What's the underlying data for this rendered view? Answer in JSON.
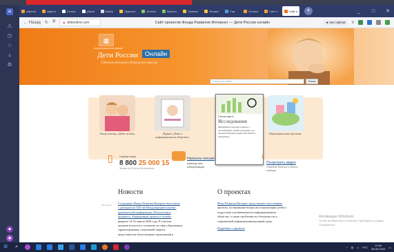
{
  "browser": {
    "tabs": [
      {
        "label": "sapienti",
        "active": false
      },
      {
        "label": "sapient",
        "active": false
      },
      {
        "label": "Статьи",
        "active": false
      },
      {
        "label": "pdfpdf",
        "active": false
      },
      {
        "label": "Кибер",
        "active": false
      },
      {
        "label": "Правила",
        "active": false
      },
      {
        "label": "Оплата",
        "active": false
      },
      {
        "label": "Валюта",
        "active": false
      },
      {
        "label": "Гуманит",
        "active": false
      },
      {
        "label": "Финанс",
        "active": false
      },
      {
        "label": "Faq",
        "active": false
      },
      {
        "label": "Оплата",
        "active": false
      },
      {
        "label": "Сайт п",
        "active": false
      },
      {
        "label": "Сайт п",
        "active": true
      }
    ],
    "tab_add": "+",
    "window_buttons": [
      "_",
      "□",
      "✕"
    ],
    "back_label": "← Назад",
    "url": "detionline.com",
    "page_title": "Сайт проектов Фонда Развития Интернет — Дети России онлайн",
    "bookmark_label": "★ Нет сайтов",
    "colors": {
      "tabstrip": "#2f3b68",
      "banner": "#f07b16",
      "link": "#1a4f8b",
      "accent": "#e8751b"
    }
  },
  "site": {
    "logo_caption": "ФОНД РАЗВИТИЯ ИНТЕРНЕТ",
    "logo_main": "Дети России",
    "logo_badge": "Онлайн",
    "slogan": "Сделаем интернет безопаснее вместе",
    "search_placeholder": "Поиск на сайте",
    "search_button": "Поиск"
  },
  "cards": [
    {
      "label": "Линия помощи «Дети онлайн»"
    },
    {
      "label": "Журнал «Дети в информационном обществе»"
    },
    {
      "label": "Образовательные проекты"
    }
  ],
  "popup": {
    "kicker": "Статистика и",
    "title": "Исследования",
    "text": "Проводятся научные опросы и исследования, чтобы понимать, на сколько безопасна среда для детей в интернете."
  },
  "hotline": {
    "label": "Горячая линия",
    "number_a": "8 800",
    "number_b": "25 000 15",
    "note": "Звонки по России бесплатные"
  },
  "chat": {
    "link": "Написать письмо",
    "sub": "помощь или консультация"
  },
  "video": {
    "link": "Посмотреть видео",
    "sub": "Узнайте больше о Линии помощи"
  },
  "news": {
    "heading": "Новости",
    "date": "обновлено",
    "lines": [
      "Сотрудники Фонда Развития Интернет выступили",
      "с докладом на XIII-ой Международной научно-",
      "практической конференции «Психология и",
      "интернет». Конференция прошла в онлайн-",
      "формате 14-16 апреля 2020 года. В участии",
      "приняли психологи, специалисты сфер образования,",
      "здравоохранения, социальной защиты,",
      "представители общественных организаций и"
    ]
  },
  "about": {
    "heading": "О проектах",
    "lines": [
      "Фонд Развития Интернет представляет свои главные",
      "проекты, посвящённые вопросам социализации детей и",
      "подростков в развивающемся информационном",
      "обществе, а также проблемам их безопасности в",
      "современной инфокоммуникационной среде."
    ],
    "more": "Подробнее о проектах"
  },
  "watermark": {
    "line1": "Активация Windows",
    "line2": "Чтобы активировать Windows, перейдите в раздел",
    "line3": "\"Параметры\"."
  },
  "taskbar": {
    "tray_lang": "РУС",
    "time": "13:06",
    "date": "08.06.2020"
  }
}
